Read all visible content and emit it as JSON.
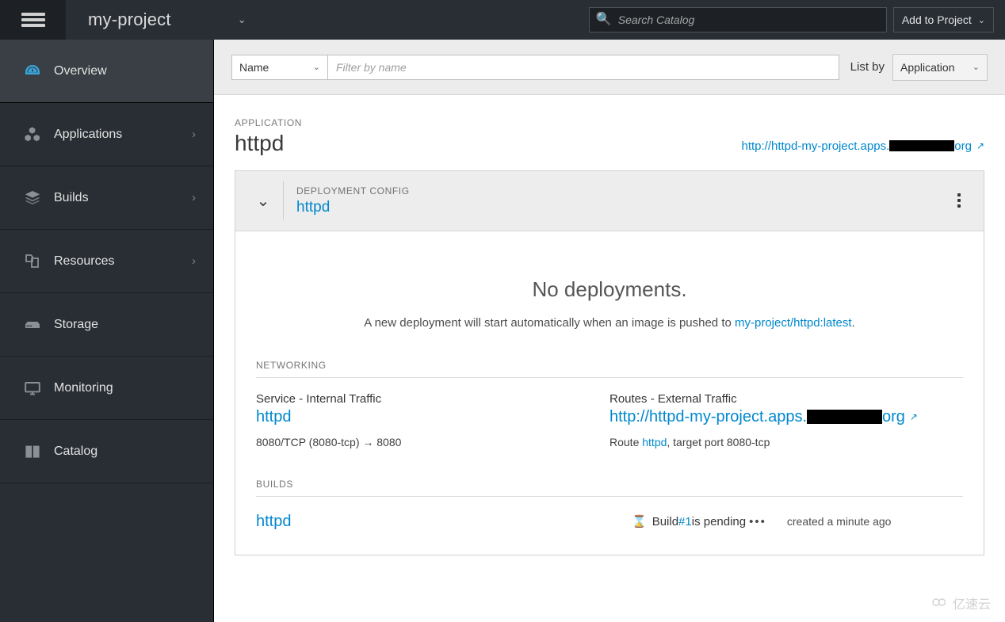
{
  "topbar": {
    "menu_icon": "hamburger-icon",
    "project_name": "my-project",
    "project_caret": "⌄",
    "search": {
      "icon": "search-icon",
      "placeholder": "Search Catalog",
      "value": ""
    },
    "add_to_project": {
      "label": "Add to Project",
      "caret": "⌄"
    }
  },
  "sidebar": {
    "items": [
      {
        "label": "Overview",
        "icon": "dashboard-gauge-icon",
        "active": true,
        "chevron": ""
      },
      {
        "label": "Applications",
        "icon": "cubes-icon",
        "active": false,
        "chevron": "›"
      },
      {
        "label": "Builds",
        "icon": "layers-icon",
        "active": false,
        "chevron": "›"
      },
      {
        "label": "Resources",
        "icon": "documents-icon",
        "active": false,
        "chevron": "›"
      },
      {
        "label": "Storage",
        "icon": "storage-icon",
        "active": false,
        "chevron": ""
      },
      {
        "label": "Monitoring",
        "icon": "monitor-icon",
        "active": false,
        "chevron": ""
      },
      {
        "label": "Catalog",
        "icon": "book-icon",
        "active": false,
        "chevron": ""
      }
    ]
  },
  "filterbar": {
    "filter_type": "Name",
    "filter_caret": "⌄",
    "filter_placeholder": "Filter by name",
    "filter_value": "",
    "list_by_label": "List by",
    "list_by_value": "Application",
    "list_by_caret": "⌄"
  },
  "application": {
    "kicker": "APPLICATION",
    "name": "httpd",
    "url_prefix": "http://httpd-my-project.apps.",
    "url_suffix": "org",
    "url_redacted": true,
    "external_icon": "↗"
  },
  "deployment_config": {
    "collapse_icon": "⌄",
    "kicker": "DEPLOYMENT CONFIG",
    "name": "httpd",
    "kebab_icon": "kebab-menu-icon"
  },
  "empty_state": {
    "title": "No deployments.",
    "subtitle_before": "A new deployment will start automatically when an image is pushed to ",
    "image_link": "my-project/httpd:latest",
    "subtitle_after": "."
  },
  "networking": {
    "kicker": "NETWORKING",
    "service": {
      "label": "Service - Internal Traffic",
      "name": "httpd",
      "ports": "8080/TCP (8080-tcp) → 8080"
    },
    "routes": {
      "label": "Routes - External Traffic",
      "url_prefix": "http://httpd-my-project.apps.",
      "url_suffix": "org",
      "external_icon": "↗",
      "detail_before": "Route ",
      "detail_link": "httpd",
      "detail_after": ", target port 8080-tcp"
    }
  },
  "builds": {
    "kicker": "BUILDS",
    "name": "httpd",
    "status_icon": "hourglass-icon",
    "status_before": "Build ",
    "status_link": "#1",
    "status_after": " is pending",
    "status_dots": "•••",
    "created": "created a minute ago"
  },
  "watermark": {
    "icon": "cloud-icon",
    "text": "亿速云"
  },
  "colors": {
    "topbar_bg": "#292e34",
    "sidebar_bg": "#292e34",
    "sidebar_active_bg": "#393f44",
    "accent_link": "#0088ce",
    "accent_icon": "#39a5dc",
    "filterbar_bg": "#ececec",
    "card_head_bg": "#ededed"
  }
}
